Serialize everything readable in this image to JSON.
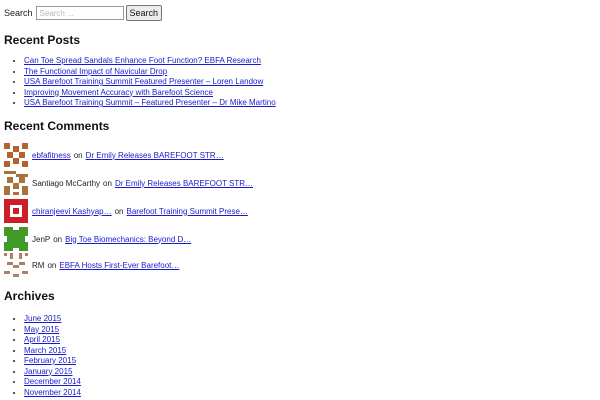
{
  "search": {
    "label": "Search",
    "placeholder": "Search ...",
    "button_label": "Search"
  },
  "recent_posts": {
    "heading": "Recent Posts",
    "items": [
      "Can Toe Spread Sandals Enhance Foot Function? EBFA Research",
      "The Functional Impact of Navicular Drop",
      "USA Barefoot Training Summit Featured Presenter – Loren Landow",
      "Improving Movement Accuracy with Barefoot Science",
      "USA Barefoot Training Summit – Featured Presenter – Dr Mike Martino"
    ]
  },
  "recent_comments": {
    "heading": "Recent Comments",
    "items": [
      {
        "author": "ebfafitness",
        "author_linked": true,
        "on": "on",
        "post": "Dr Emily Releases BAREFOOT STR…",
        "avatar_color": "#b4632c"
      },
      {
        "author": "Santiago McCarthy",
        "author_linked": false,
        "on": "on",
        "post": "Dr Emily Releases BAREFOOT STR…",
        "avatar_color": "#a8733a"
      },
      {
        "author": "chiranjeevi Kashyap…",
        "author_linked": true,
        "on": "on",
        "post": "Barefoot Training Summit Prese…",
        "avatar_color": "#cc1f2a"
      },
      {
        "author": "JenP",
        "author_linked": false,
        "on": "on",
        "post": "Big Toe Biomechanics: Beyond D…",
        "avatar_color": "#3f9a2a"
      },
      {
        "author": "RM",
        "author_linked": false,
        "on": "on",
        "post": "EBFA Hosts First-Ever Barefoot…",
        "avatar_color": "#b07f6a"
      }
    ]
  },
  "archives": {
    "heading": "Archives",
    "items": [
      "June 2015",
      "May 2015",
      "April 2015",
      "March 2015",
      "February 2015",
      "January 2015",
      "December 2014",
      "November 2014"
    ]
  },
  "colors": {
    "link": "#1a1acc",
    "heading": "#111111"
  }
}
